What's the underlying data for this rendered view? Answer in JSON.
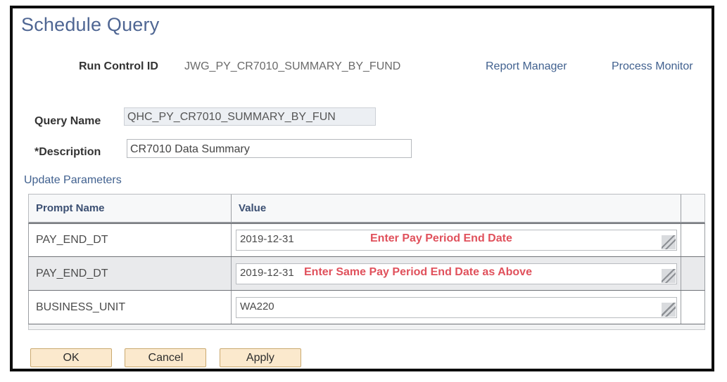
{
  "page": {
    "title": "Schedule Query"
  },
  "header": {
    "run_control_label": "Run Control ID",
    "run_control_value": "JWG_PY_CR7010_SUMMARY_BY_FUND",
    "report_manager_link": "Report Manager",
    "process_monitor_link": "Process Monitor"
  },
  "form": {
    "query_name_label": "Query Name",
    "query_name_value": "QHC_PY_CR7010_SUMMARY_BY_FUN",
    "description_label": "*Description",
    "description_value": "CR7010 Data Summary",
    "update_parameters_link": "Update Parameters"
  },
  "grid": {
    "columns": [
      "Prompt Name",
      "Value",
      ""
    ],
    "rows": [
      {
        "prompt_name": "PAY_END_DT",
        "value": "2019-12-31",
        "note": "Enter Pay Period End Date"
      },
      {
        "prompt_name": "PAY_END_DT",
        "value": "2019-12-31",
        "note": "Enter Same Pay Period End Date as Above"
      },
      {
        "prompt_name": "BUSINESS_UNIT",
        "value": "WA220",
        "note": ""
      }
    ]
  },
  "buttons": {
    "ok": "OK",
    "cancel": "Cancel",
    "apply": "Apply"
  },
  "colors": {
    "title_blue": "#4f6693",
    "link_blue": "#41618f",
    "note_red": "#e0515c",
    "button_tan": "#fbe9cd",
    "grid_header_text": "#3b4f72"
  }
}
